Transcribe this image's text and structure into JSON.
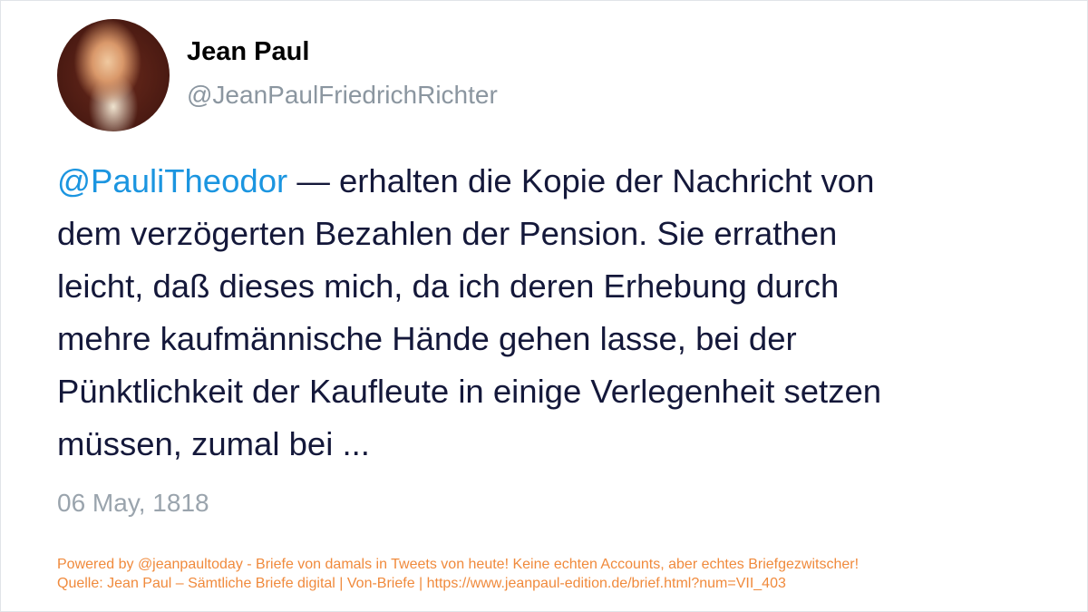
{
  "author": {
    "name": "Jean Paul",
    "handle": "@JeanPaulFriedrichRichter",
    "avatar_icon": "portrait-avatar"
  },
  "tweet": {
    "mention": "@PauliTheodor",
    "lines": [
      " — erhalten die Kopie der Nachricht von",
      "dem verzögerten Bezahlen der Pension. Sie errathen",
      "leicht, daß dieses mich, da ich deren Erhebung durch",
      "mehre kaufmännische Hände gehen lasse, bei der",
      "Pünktlichkeit der Kaufleute in einige Verlegenheit setzen",
      "müssen, zumal bei ..."
    ],
    "date": "06 May, 1818"
  },
  "footer": {
    "line1": "Powered by @jeanpaultoday - Briefe von damals in Tweets von heute! Keine echten Accounts, aber echtes Briefgezwitscher!",
    "line2": "Quelle: Jean Paul – Sämtliche Briefe digital | Von-Briefe | https://www.jeanpaul-edition.de/brief.html?num=VII_403"
  },
  "colors": {
    "mention": "#1b95e0",
    "footer": "#f08a3c",
    "text": "#14183a",
    "muted": "#9aa4ad"
  }
}
